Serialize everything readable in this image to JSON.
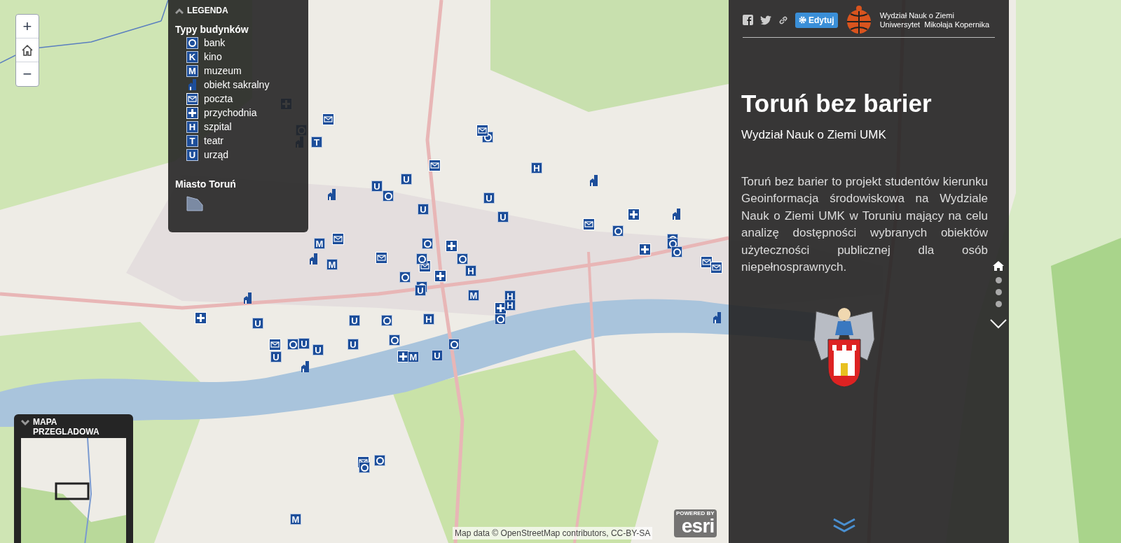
{
  "zoom_controls": {
    "zoom_in": "+",
    "zoom_out": "−"
  },
  "legend": {
    "title": "LEGENDA",
    "types_heading": "Typy budynków",
    "types": [
      {
        "kind": "bank",
        "label": "bank"
      },
      {
        "kind": "letter",
        "symbol": "K",
        "label": "kino"
      },
      {
        "kind": "letter",
        "symbol": "M",
        "label": "muzeum"
      },
      {
        "kind": "church",
        "label": "obiekt sakralny"
      },
      {
        "kind": "mail",
        "label": "poczta"
      },
      {
        "kind": "plus",
        "label": "przychodnia"
      },
      {
        "kind": "letter",
        "symbol": "H",
        "label": "szpital"
      },
      {
        "kind": "letter",
        "symbol": "T",
        "label": "teatr"
      },
      {
        "kind": "letter",
        "symbol": "U",
        "label": "urząd"
      }
    ],
    "area_heading": "Miasto Toruń"
  },
  "map_markers": [
    {
      "kind": "plus"
    },
    {
      "kind": "mail"
    },
    {
      "kind": "bank"
    },
    {
      "kind": "church"
    },
    {
      "kind": "letter",
      "symbol": "T"
    },
    {
      "kind": "church"
    },
    {
      "kind": "bank"
    },
    {
      "kind": "mail"
    },
    {
      "kind": "letter",
      "symbol": "U"
    },
    {
      "kind": "letter",
      "symbol": "U"
    },
    {
      "kind": "bank"
    },
    {
      "kind": "mail"
    },
    {
      "kind": "letter",
      "symbol": "U"
    },
    {
      "kind": "bank"
    },
    {
      "kind": "letter",
      "symbol": "U"
    },
    {
      "kind": "letter",
      "symbol": "H"
    },
    {
      "kind": "letter",
      "symbol": "U"
    },
    {
      "kind": "plus"
    },
    {
      "kind": "mail"
    },
    {
      "kind": "letter",
      "symbol": "M"
    },
    {
      "kind": "church"
    },
    {
      "kind": "mail"
    },
    {
      "kind": "letter",
      "symbol": "M"
    },
    {
      "kind": "mail"
    },
    {
      "kind": "bank"
    },
    {
      "kind": "bank"
    },
    {
      "kind": "plus"
    },
    {
      "kind": "bank"
    },
    {
      "kind": "bank"
    },
    {
      "kind": "letter",
      "symbol": "H"
    },
    {
      "kind": "letter",
      "symbol": "U"
    },
    {
      "kind": "letter",
      "symbol": "M"
    },
    {
      "kind": "church"
    },
    {
      "kind": "plus"
    },
    {
      "kind": "letter",
      "symbol": "U"
    },
    {
      "kind": "letter",
      "symbol": "U"
    },
    {
      "kind": "mail"
    },
    {
      "kind": "bank"
    },
    {
      "kind": "letter",
      "symbol": "U"
    },
    {
      "kind": "letter",
      "symbol": "U"
    },
    {
      "kind": "letter",
      "symbol": "U"
    },
    {
      "kind": "letter",
      "symbol": "U"
    },
    {
      "kind": "bank"
    },
    {
      "kind": "bank"
    },
    {
      "kind": "plus"
    },
    {
      "kind": "bank"
    },
    {
      "kind": "letter",
      "symbol": "M"
    },
    {
      "kind": "letter",
      "symbol": "U"
    },
    {
      "kind": "bank"
    },
    {
      "kind": "letter",
      "symbol": "H"
    },
    {
      "kind": "plus"
    },
    {
      "kind": "letter",
      "symbol": "H"
    },
    {
      "kind": "church"
    },
    {
      "kind": "mail"
    },
    {
      "kind": "bank"
    },
    {
      "kind": "bank"
    },
    {
      "kind": "plus"
    },
    {
      "kind": "mail"
    },
    {
      "kind": "bank"
    },
    {
      "kind": "bank"
    },
    {
      "kind": "church"
    },
    {
      "kind": "plus"
    },
    {
      "kind": "mail"
    },
    {
      "kind": "bank"
    },
    {
      "kind": "mail"
    },
    {
      "kind": "letter",
      "symbol": "M"
    },
    {
      "kind": "church"
    },
    {
      "kind": "church"
    },
    {
      "kind": "bank"
    },
    {
      "kind": "letter",
      "symbol": "H"
    }
  ],
  "overview": {
    "title": "MAPA PRZEGLADOWA"
  },
  "attribution": "Map data © OpenStreetMap contributors, CC-BY-SA",
  "esri": {
    "powered": "POWERED BY",
    "logo": "esri"
  },
  "panel": {
    "edit_button": "Edytuj",
    "org_lines": [
      "Wydział Nauk o Ziemi",
      "Uniwersytet  Mikołaja Kopernika"
    ],
    "title": "Toruń bez barier",
    "subtitle": "Wydział Nauk o Ziemi UMK",
    "body": "Toruń bez barier to projekt studentów kierunku Geoinformacja środowiskowa na Wydziale Nauk o Ziemi UMK w Toruniu mający na celu analizę dostępności wybranych obiektów użyteczności publicznej dla osób niepełnosprawnych.",
    "sections": [
      {
        "kind": "home",
        "selected": true
      },
      {
        "kind": "dot",
        "selected": false
      },
      {
        "kind": "dot",
        "selected": false
      },
      {
        "kind": "dot",
        "selected": false
      }
    ]
  }
}
